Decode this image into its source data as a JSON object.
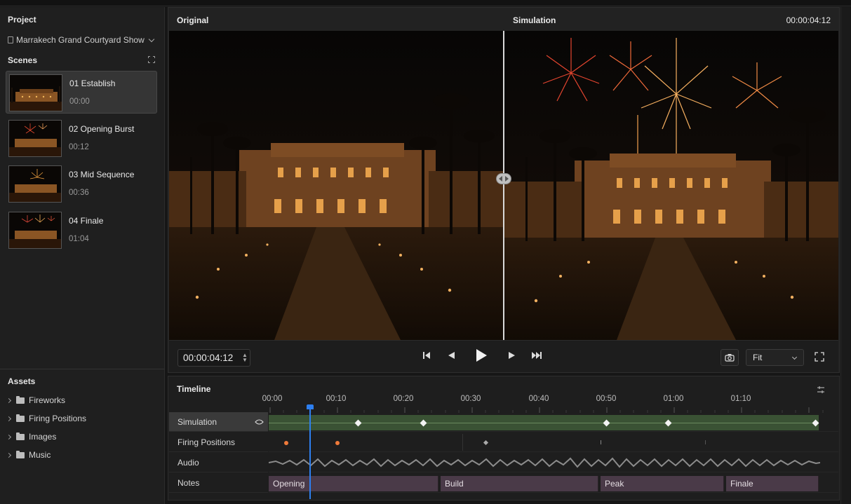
{
  "left": {
    "project_title": "Project",
    "project_name": "Marrakech Grand Courtyard Show",
    "scenes_title": "Scenes",
    "scenes": [
      {
        "name": "01 Establish",
        "time": "00:00"
      },
      {
        "name": "02 Opening Burst",
        "time": "00:12"
      },
      {
        "name": "03 Mid Sequence",
        "time": "00:36"
      },
      {
        "name": "04 Finale",
        "time": "01:04"
      }
    ],
    "assets_title": "Assets",
    "assets": [
      "Fireworks",
      "Firing Positions",
      "Images",
      "Music"
    ]
  },
  "viewer": {
    "original_label": "Original",
    "simulation_label": "Simulation",
    "timecode_top": "00:00:04:12",
    "timecode": "00:00:04:12",
    "fit_value": "Fit"
  },
  "timeline": {
    "title": "Timeline",
    "ticks": [
      "00:00",
      "00:10",
      "00:20",
      "00:30",
      "00:40",
      "00:50",
      "01:00",
      "01:10"
    ],
    "tracks": [
      "Simulation",
      "Firing Positions",
      "Audio",
      "Notes"
    ],
    "notes": [
      "Opening",
      "Build",
      "Peak",
      "Finale"
    ]
  },
  "icons": [
    "document-icon",
    "chevron-down-icon",
    "fit-frame-icon",
    "caret-right-icon",
    "folder-icon",
    "split-handle-icon",
    "stepper-icon",
    "skip-to-start-icon",
    "step-back-icon",
    "play-icon",
    "step-forward-icon",
    "fast-forward-icon",
    "camera-icon",
    "fullscreen-icon",
    "eye-icon",
    "tracks-settings-icon"
  ],
  "colors": {
    "accent": "#2d7ff0",
    "simulation_track": "#3a5234",
    "firing_marker": "#f07a3a",
    "notes_track": "#4a3a48"
  }
}
